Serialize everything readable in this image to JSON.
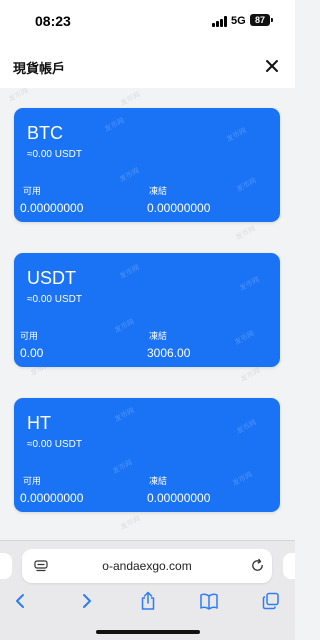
{
  "status_bar": {
    "time": "08:23",
    "network": "5G",
    "battery": "87"
  },
  "header": {
    "title": "現貨帳戶",
    "close_icon": "close-icon"
  },
  "watermark_text": "发币网",
  "accounts": [
    {
      "symbol": "BTC",
      "approx_value": "≈0.00 USDT",
      "available_label": "可用",
      "available_value": "0.00000000",
      "frozen_label": "凍結",
      "frozen_value": "0.00000000"
    },
    {
      "symbol": "USDT",
      "approx_value": "≈0.00 USDT",
      "available_label": "可用",
      "available_value": "0.00",
      "frozen_label": "凍結",
      "frozen_value": "3006.00"
    },
    {
      "symbol": "HT",
      "approx_value": "≈0.00 USDT",
      "available_label": "可用",
      "available_value": "0.00000000",
      "frozen_label": "凍結",
      "frozen_value": "0.00000000"
    }
  ],
  "browser": {
    "url": "o-andaexgo.com",
    "icons": [
      "page-menu-icon",
      "reload-icon",
      "back-icon",
      "forward-icon",
      "share-icon",
      "bookmarks-icon",
      "tabs-icon"
    ]
  },
  "colors": {
    "card_blue": "#1a73f5",
    "toolbar_blue": "#2f7cf6",
    "page_bg": "#f2f3f5"
  }
}
